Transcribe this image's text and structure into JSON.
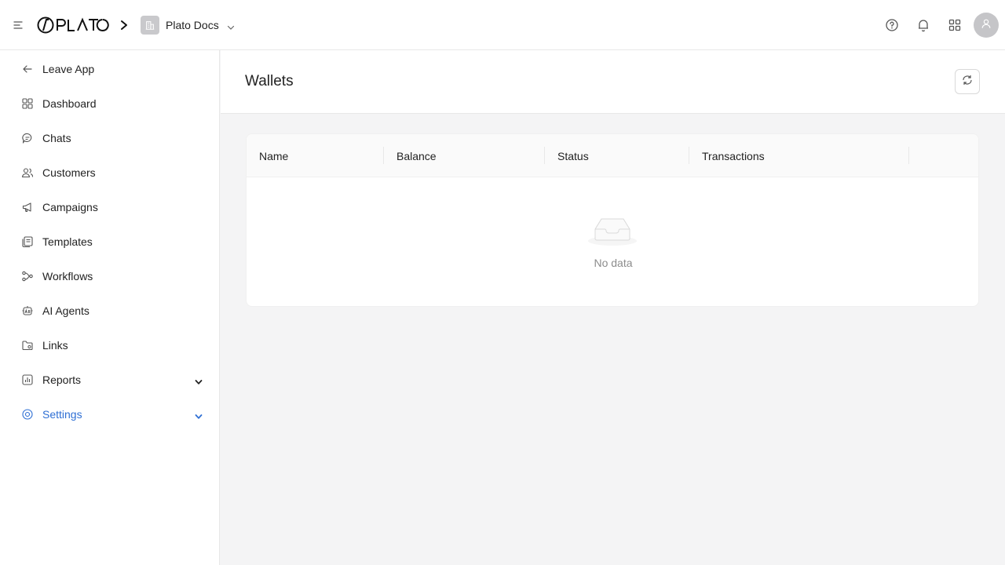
{
  "app": {
    "logo_text": "PLATO",
    "workspace_name": "Plato Docs"
  },
  "icons": {
    "menu": "menu-icon",
    "breadcrumb": "chevron-right-icon",
    "workspace": "building-icon",
    "help": "help-circle-icon",
    "notifications": "bell-icon",
    "apps": "apps-grid-icon",
    "avatar": "user-icon",
    "refresh": "refresh-icon"
  },
  "sidebar": {
    "items": [
      {
        "label": "Leave App",
        "icon": "arrow-left-icon"
      },
      {
        "label": "Dashboard",
        "icon": "dashboard-icon"
      },
      {
        "label": "Chats",
        "icon": "chat-icon"
      },
      {
        "label": "Customers",
        "icon": "users-icon"
      },
      {
        "label": "Campaigns",
        "icon": "megaphone-icon"
      },
      {
        "label": "Templates",
        "icon": "templates-icon"
      },
      {
        "label": "Workflows",
        "icon": "workflow-icon"
      },
      {
        "label": "AI Agents",
        "icon": "ai-agent-icon"
      },
      {
        "label": "Links",
        "icon": "link-folder-icon"
      },
      {
        "label": "Reports",
        "icon": "reports-icon",
        "expandable": true
      },
      {
        "label": "Settings",
        "icon": "settings-icon",
        "expandable": true,
        "active": true
      }
    ]
  },
  "page": {
    "title": "Wallets"
  },
  "table": {
    "columns": [
      "Name",
      "Balance",
      "Status",
      "Transactions"
    ],
    "rows": [],
    "empty_text": "No data"
  },
  "colors": {
    "accent": "#2e6fd4",
    "background": "#f4f4f5",
    "border": "#e8e8e8"
  }
}
